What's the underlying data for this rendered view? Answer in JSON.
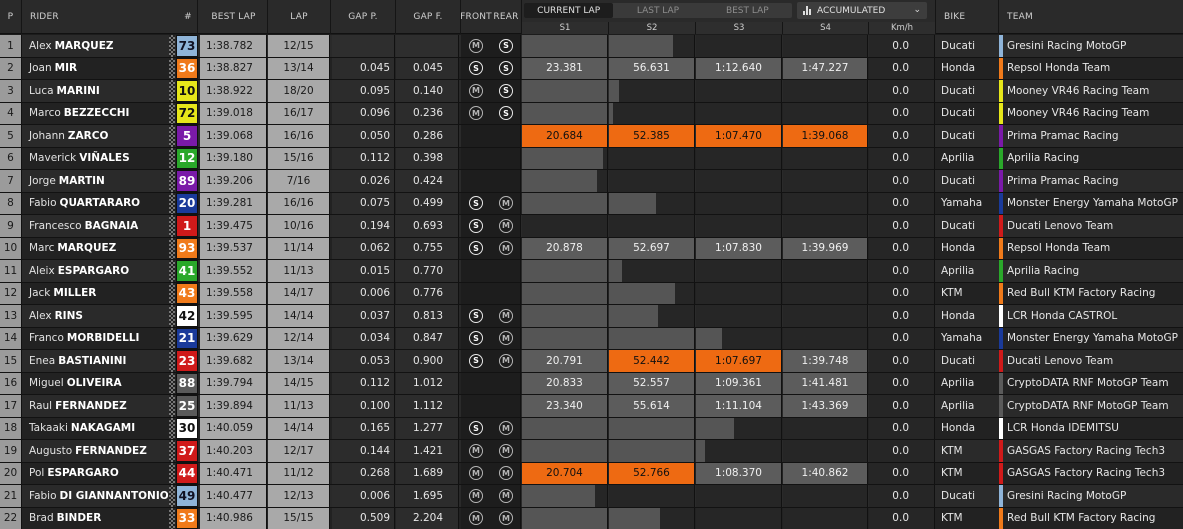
{
  "header": {
    "p": "P",
    "rider": "RIDER",
    "num": "#",
    "best_lap": "BEST LAP",
    "lap": "LAP",
    "gap_p": "GAP P.",
    "gap_f": "GAP F.",
    "front": "FRONT",
    "rear": "REAR",
    "bike": "BIKE",
    "team": "TEAM",
    "tabs": [
      "CURRENT LAP",
      "LAST LAP",
      "BEST LAP"
    ],
    "active_tab": "CURRENT LAP",
    "view_select": "ACCUMULATED",
    "s1": "S1",
    "s2": "S2",
    "s3": "S3",
    "s4": "S4",
    "kmh": "Km/h"
  },
  "colors": {
    "orange": "#ee6a12",
    "sector_grey": "#5c5c5c"
  },
  "rows": [
    {
      "pos": "1",
      "first": "Alex",
      "last": "MARQUEZ",
      "num": "73",
      "num_bg": "#8fb4d8",
      "num_fg": "#112",
      "best": "1:38.782",
      "lap": "12/15",
      "gap_p": "",
      "gap_f": "",
      "front": "M",
      "rear": "S",
      "s1": "",
      "s2": "",
      "s3": "",
      "s4": "",
      "bar": [
        1,
        0.75,
        0,
        0
      ],
      "kmh": "0.0",
      "bike": "Ducati",
      "team": "Gresini Racing MotoGP",
      "team_color": "#8fb4d8"
    },
    {
      "pos": "2",
      "first": "Joan",
      "last": "MIR",
      "num": "36",
      "num_bg": "#f07a1a",
      "num_fg": "#fff",
      "best": "1:38.827",
      "lap": "13/14",
      "gap_p": "0.045",
      "gap_f": "0.045",
      "front": "S",
      "rear": "S",
      "s1": "23.381",
      "s2": "56.631",
      "s3": "1:12.640",
      "s4": "1:47.227",
      "sect_style": [
        "grey",
        "grey",
        "grey",
        "grey"
      ],
      "kmh": "0.0",
      "bike": "Honda",
      "team": "Repsol Honda Team",
      "team_color": "#f07a1a"
    },
    {
      "pos": "3",
      "first": "Luca",
      "last": "MARINI",
      "num": "10",
      "num_bg": "#e6e61a",
      "num_fg": "#111",
      "best": "1:38.922",
      "lap": "18/20",
      "gap_p": "0.095",
      "gap_f": "0.140",
      "front": "M",
      "rear": "S",
      "s1": "",
      "s2": "",
      "s3": "",
      "s4": "",
      "bar": [
        1,
        0.12,
        0,
        0
      ],
      "kmh": "0.0",
      "bike": "Ducati",
      "team": "Mooney VR46 Racing Team",
      "team_color": "#e6e61a"
    },
    {
      "pos": "4",
      "first": "Marco",
      "last": "BEZZECCHI",
      "num": "72",
      "num_bg": "#e6e61a",
      "num_fg": "#111",
      "best": "1:39.018",
      "lap": "16/17",
      "gap_p": "0.096",
      "gap_f": "0.236",
      "front": "M",
      "rear": "S",
      "s1": "",
      "s2": "",
      "s3": "",
      "s4": "",
      "bar": [
        1,
        0.05,
        0,
        0
      ],
      "kmh": "0.0",
      "bike": "Ducati",
      "team": "Mooney VR46 Racing Team",
      "team_color": "#e6e61a"
    },
    {
      "pos": "5",
      "first": "Johann",
      "last": "ZARCO",
      "num": "5",
      "num_bg": "#7a1aa8",
      "num_fg": "#fff",
      "best": "1:39.068",
      "lap": "16/16",
      "gap_p": "0.050",
      "gap_f": "0.286",
      "front": "",
      "rear": "",
      "s1": "20.684",
      "s2": "52.385",
      "s3": "1:07.470",
      "s4": "1:39.068",
      "sect_style": [
        "orange",
        "orange",
        "orange",
        "orange"
      ],
      "kmh": "0.0",
      "bike": "Ducati",
      "team": "Prima Pramac Racing",
      "team_color": "#7a1aa8"
    },
    {
      "pos": "6",
      "first": "Maverick",
      "last": "VIÑALES",
      "num": "12",
      "num_bg": "#2aa82a",
      "num_fg": "#fff",
      "best": "1:39.180",
      "lap": "15/16",
      "gap_p": "0.112",
      "gap_f": "0.398",
      "front": "",
      "rear": "",
      "s1": "",
      "s2": "",
      "s3": "",
      "s4": "",
      "bar": [
        0.95,
        0,
        0,
        0
      ],
      "kmh": "0.0",
      "bike": "Aprilia",
      "team": "Aprilia Racing",
      "team_color": "#2aa82a"
    },
    {
      "pos": "7",
      "first": "Jorge",
      "last": "MARTIN",
      "num": "89",
      "num_bg": "#7a1aa8",
      "num_fg": "#fff",
      "best": "1:39.206",
      "lap": "7/16",
      "gap_p": "0.026",
      "gap_f": "0.424",
      "front": "",
      "rear": "",
      "s1": "",
      "s2": "",
      "s3": "",
      "s4": "",
      "bar": [
        0.88,
        0,
        0,
        0
      ],
      "kmh": "0.0",
      "bike": "Ducati",
      "team": "Prima Pramac Racing",
      "team_color": "#7a1aa8"
    },
    {
      "pos": "8",
      "first": "Fabio",
      "last": "QUARTARARO",
      "num": "20",
      "num_bg": "#1a3a9a",
      "num_fg": "#fff",
      "best": "1:39.281",
      "lap": "16/16",
      "gap_p": "0.075",
      "gap_f": "0.499",
      "front": "S",
      "rear": "M",
      "s1": "",
      "s2": "",
      "s3": "",
      "s4": "",
      "bar": [
        1,
        0.55,
        0,
        0
      ],
      "kmh": "0.0",
      "bike": "Yamaha",
      "team": "Monster Energy Yamaha MotoGP",
      "team_color": "#1a3a9a"
    },
    {
      "pos": "9",
      "first": "Francesco",
      "last": "BAGNAIA",
      "num": "1",
      "num_bg": "#d01a1a",
      "num_fg": "#fff",
      "best": "1:39.475",
      "lap": "10/16",
      "gap_p": "0.194",
      "gap_f": "0.693",
      "front": "S",
      "rear": "M",
      "s1": "",
      "s2": "",
      "s3": "",
      "s4": "",
      "bar": [
        0,
        0,
        0,
        0
      ],
      "kmh": "0.0",
      "bike": "Ducati",
      "team": "Ducati Lenovo Team",
      "team_color": "#d01a1a"
    },
    {
      "pos": "10",
      "first": "Marc",
      "last": "MARQUEZ",
      "num": "93",
      "num_bg": "#f07a1a",
      "num_fg": "#fff",
      "best": "1:39.537",
      "lap": "11/14",
      "gap_p": "0.062",
      "gap_f": "0.755",
      "front": "S",
      "rear": "M",
      "s1": "20.878",
      "s2": "52.697",
      "s3": "1:07.830",
      "s4": "1:39.969",
      "sect_style": [
        "grey",
        "grey",
        "grey",
        "grey"
      ],
      "kmh": "0.0",
      "bike": "Honda",
      "team": "Repsol Honda Team",
      "team_color": "#f07a1a"
    },
    {
      "pos": "11",
      "first": "Aleix",
      "last": "ESPARGARO",
      "num": "41",
      "num_bg": "#2aa82a",
      "num_fg": "#fff",
      "best": "1:39.552",
      "lap": "11/13",
      "gap_p": "0.015",
      "gap_f": "0.770",
      "front": "",
      "rear": "",
      "s1": "",
      "s2": "",
      "s3": "",
      "s4": "",
      "bar": [
        1,
        0.15,
        0,
        0
      ],
      "kmh": "0.0",
      "bike": "Aprilia",
      "team": "Aprilia Racing",
      "team_color": "#2aa82a"
    },
    {
      "pos": "12",
      "first": "Jack",
      "last": "MILLER",
      "num": "43",
      "num_bg": "#f07a1a",
      "num_fg": "#fff",
      "best": "1:39.558",
      "lap": "14/17",
      "gap_p": "0.006",
      "gap_f": "0.776",
      "front": "",
      "rear": "",
      "s1": "",
      "s2": "",
      "s3": "",
      "s4": "",
      "bar": [
        1,
        0.78,
        0,
        0
      ],
      "kmh": "0.0",
      "bike": "KTM",
      "team": "Red Bull KTM Factory Racing",
      "team_color": "#f07a1a"
    },
    {
      "pos": "13",
      "first": "Alex",
      "last": "RINS",
      "num": "42",
      "num_bg": "#ffffff",
      "num_fg": "#111",
      "best": "1:39.595",
      "lap": "14/14",
      "gap_p": "0.037",
      "gap_f": "0.813",
      "front": "S",
      "rear": "M",
      "s1": "",
      "s2": "",
      "s3": "",
      "s4": "",
      "bar": [
        1,
        0.58,
        0,
        0
      ],
      "kmh": "0.0",
      "bike": "Honda",
      "team": "LCR Honda CASTROL",
      "team_color": "#ffffff"
    },
    {
      "pos": "14",
      "first": "Franco",
      "last": "MORBIDELLI",
      "num": "21",
      "num_bg": "#1a3a9a",
      "num_fg": "#fff",
      "best": "1:39.629",
      "lap": "12/14",
      "gap_p": "0.034",
      "gap_f": "0.847",
      "front": "S",
      "rear": "M",
      "s1": "",
      "s2": "",
      "s3": "",
      "s4": "",
      "bar": [
        1,
        1,
        0.3,
        0
      ],
      "kmh": "0.0",
      "bike": "Yamaha",
      "team": "Monster Energy Yamaha MotoGP",
      "team_color": "#1a3a9a"
    },
    {
      "pos": "15",
      "first": "Enea",
      "last": "BASTIANINI",
      "num": "23",
      "num_bg": "#d01a1a",
      "num_fg": "#fff",
      "best": "1:39.682",
      "lap": "13/14",
      "gap_p": "0.053",
      "gap_f": "0.900",
      "front": "S",
      "rear": "M",
      "s1": "20.791",
      "s2": "52.442",
      "s3": "1:07.697",
      "s4": "1:39.748",
      "sect_style": [
        "grey",
        "orange",
        "orange",
        "grey"
      ],
      "kmh": "0.0",
      "bike": "Ducati",
      "team": "Ducati Lenovo Team",
      "team_color": "#d01a1a"
    },
    {
      "pos": "16",
      "first": "Miguel",
      "last": "OLIVEIRA",
      "num": "88",
      "num_bg": "#5a5a5a",
      "num_fg": "#fff",
      "best": "1:39.794",
      "lap": "14/15",
      "gap_p": "0.112",
      "gap_f": "1.012",
      "front": "",
      "rear": "",
      "s1": "20.833",
      "s2": "52.557",
      "s3": "1:09.361",
      "s4": "1:41.481",
      "sect_style": [
        "grey",
        "grey",
        "grey",
        "grey"
      ],
      "kmh": "0.0",
      "bike": "Aprilia",
      "team": "CryptoDATA RNF MotoGP Team",
      "team_color": "#5a5a5a"
    },
    {
      "pos": "17",
      "first": "Raul",
      "last": "FERNANDEZ",
      "num": "25",
      "num_bg": "#5a5a5a",
      "num_fg": "#fff",
      "best": "1:39.894",
      "lap": "11/13",
      "gap_p": "0.100",
      "gap_f": "1.112",
      "front": "",
      "rear": "",
      "s1": "23.340",
      "s2": "55.614",
      "s3": "1:11.104",
      "s4": "1:43.369",
      "sect_style": [
        "grey",
        "grey",
        "grey",
        "grey"
      ],
      "kmh": "0.0",
      "bike": "Aprilia",
      "team": "CryptoDATA RNF MotoGP Team",
      "team_color": "#5a5a5a"
    },
    {
      "pos": "18",
      "first": "Takaaki",
      "last": "NAKAGAMI",
      "num": "30",
      "num_bg": "#ffffff",
      "num_fg": "#111",
      "best": "1:40.059",
      "lap": "14/14",
      "gap_p": "0.165",
      "gap_f": "1.277",
      "front": "S",
      "rear": "M",
      "s1": "",
      "s2": "",
      "s3": "",
      "s4": "",
      "bar": [
        1,
        1,
        0.45,
        0
      ],
      "kmh": "0.0",
      "bike": "Honda",
      "team": "LCR Honda IDEMITSU",
      "team_color": "#ffffff"
    },
    {
      "pos": "19",
      "first": "Augusto",
      "last": "FERNANDEZ",
      "num": "37",
      "num_bg": "#d01a1a",
      "num_fg": "#fff",
      "best": "1:40.203",
      "lap": "12/17",
      "gap_p": "0.144",
      "gap_f": "1.421",
      "front": "M",
      "rear": "M",
      "s1": "",
      "s2": "",
      "s3": "",
      "s4": "",
      "bar": [
        1,
        1,
        0.1,
        0
      ],
      "kmh": "0.0",
      "bike": "KTM",
      "team": "GASGAS Factory Racing Tech3",
      "team_color": "#d01a1a"
    },
    {
      "pos": "20",
      "first": "Pol",
      "last": "ESPARGARO",
      "num": "44",
      "num_bg": "#d01a1a",
      "num_fg": "#fff",
      "best": "1:40.471",
      "lap": "11/12",
      "gap_p": "0.268",
      "gap_f": "1.689",
      "front": "M",
      "rear": "M",
      "s1": "20.704",
      "s2": "52.766",
      "s3": "1:08.370",
      "s4": "1:40.862",
      "sect_style": [
        "orange",
        "orange",
        "grey",
        "grey"
      ],
      "kmh": "0.0",
      "bike": "KTM",
      "team": "GASGAS Factory Racing Tech3",
      "team_color": "#d01a1a"
    },
    {
      "pos": "21",
      "first": "Fabio",
      "last": "DI GIANNANTONIO",
      "num": "49",
      "num_bg": "#8fb4d8",
      "num_fg": "#112",
      "best": "1:40.477",
      "lap": "12/13",
      "gap_p": "0.006",
      "gap_f": "1.695",
      "front": "M",
      "rear": "M",
      "s1": "",
      "s2": "",
      "s3": "",
      "s4": "",
      "bar": [
        0.86,
        0,
        0,
        0
      ],
      "kmh": "0.0",
      "bike": "Ducati",
      "team": "Gresini Racing MotoGP",
      "team_color": "#8fb4d8"
    },
    {
      "pos": "22",
      "first": "Brad",
      "last": "BINDER",
      "num": "33",
      "num_bg": "#f07a1a",
      "num_fg": "#fff",
      "best": "1:40.986",
      "lap": "15/15",
      "gap_p": "0.509",
      "gap_f": "2.204",
      "front": "M",
      "rear": "M",
      "s1": "",
      "s2": "",
      "s3": "",
      "s4": "",
      "bar": [
        1,
        0.6,
        0,
        0
      ],
      "kmh": "0.0",
      "bike": "KTM",
      "team": "Red Bull KTM Factory Racing",
      "team_color": "#f07a1a"
    }
  ]
}
